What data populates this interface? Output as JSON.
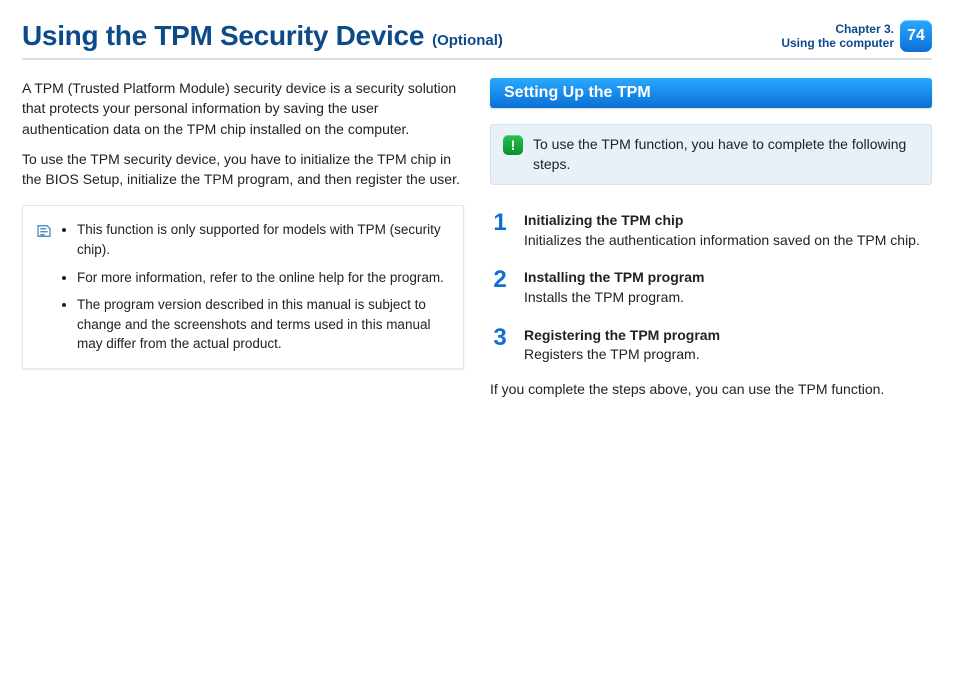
{
  "header": {
    "title": "Using the TPM Security Device",
    "subtitle": "(Optional)",
    "chapter_line1": "Chapter 3.",
    "chapter_line2": "Using the computer",
    "page_number": "74"
  },
  "left": {
    "para1": "A TPM (Trusted Platform Module) security device is a security solution that protects your personal information by saving the user authentication data on the TPM chip installed on the computer.",
    "para2": "To use the TPM security device, you have to initialize the TPM chip in the BIOS Setup, initialize the TPM program, and then register the user.",
    "notes": [
      "This function is only supported for models with TPM (security chip).",
      "For more information, refer to the online help for the program.",
      "The program version described in this manual is subject to change and the screenshots and terms used in this manual may differ from the actual product."
    ]
  },
  "right": {
    "section_title": "Setting Up the TPM",
    "alert_text": "To use the TPM function, you have to complete the following steps.",
    "steps": [
      {
        "num": "1",
        "title": "Initializing the TPM chip",
        "desc": "Initializes the authentication information saved on the TPM chip."
      },
      {
        "num": "2",
        "title": "Installing the TPM program",
        "desc": "Installs the TPM program."
      },
      {
        "num": "3",
        "title": "Registering the TPM program",
        "desc": "Registers the TPM program."
      }
    ],
    "closing": "If you complete the steps above, you can use the TPM function."
  }
}
